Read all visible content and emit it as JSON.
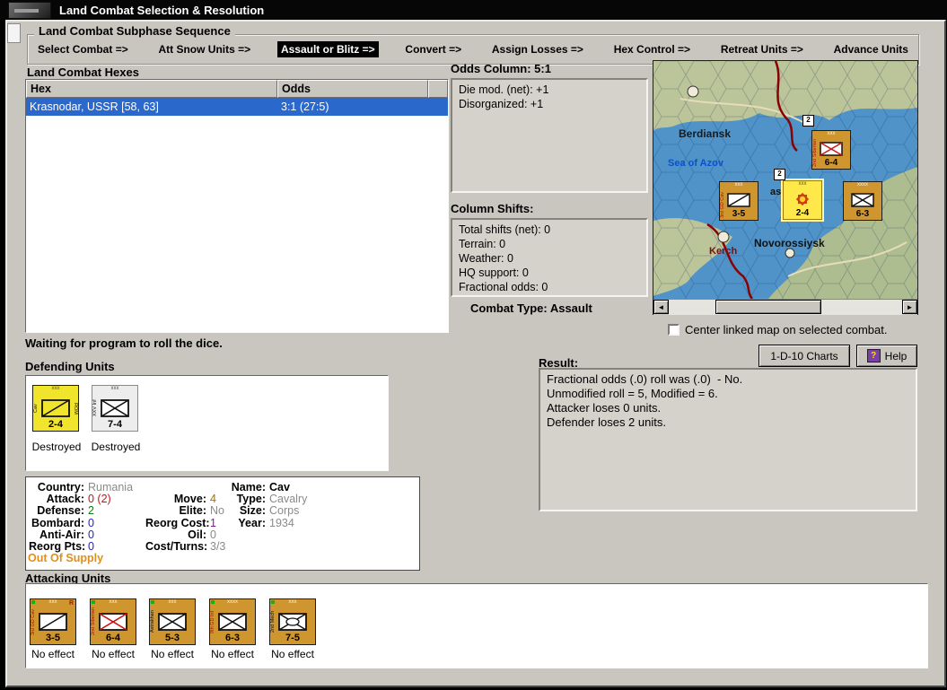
{
  "colors": {
    "titlebar": "#060606",
    "window_bg": "#c9c6c0",
    "panel_bg": "#d5d2cc",
    "selection_blue": "#2a68cc",
    "counter_orange": "#cf9630",
    "counter_yellow": "#f0e42c",
    "supply_warning_text": "#e09018",
    "map_sea": "#4f93c8",
    "map_land": "#bcc49a",
    "front_line_red": "#8b0000"
  },
  "window": {
    "title": "Land Combat Selection & Resolution"
  },
  "subphase": {
    "group_label": "Land Combat Subphase Sequence",
    "steps": [
      {
        "label": "Select Combat =>",
        "active": false
      },
      {
        "label": "Att Snow Units =>",
        "active": false
      },
      {
        "label": "Assault or Blitz =>",
        "active": true
      },
      {
        "label": "Convert =>",
        "active": false
      },
      {
        "label": "Assign Losses =>",
        "active": false
      },
      {
        "label": "Hex Control =>",
        "active": false
      },
      {
        "label": "Retreat Units =>",
        "active": false
      },
      {
        "label": "Advance Units",
        "active": false
      }
    ]
  },
  "hexes": {
    "section_label": "Land Combat Hexes",
    "col_hex": "Hex",
    "col_odds": "Odds",
    "row": {
      "hex": "Krasnodar, USSR [58, 63]",
      "odds": "3:1 (27:5)",
      "selected": true
    }
  },
  "odds": {
    "title": "Odds Column: 5:1",
    "line1": "Die mod. (net): +1",
    "line2": "Disorganized: +1"
  },
  "shifts": {
    "title": "Column Shifts:",
    "line1": "Total shifts (net): 0",
    "line2": "Terrain: 0",
    "line3": "Weather: 0",
    "line4": "HQ support: 0",
    "line5": "Fractional odds: 0"
  },
  "combat_type": "Combat Type: Assault",
  "map": {
    "label_berdiansk": "Berdiansk",
    "label_sea": "Sea of Azov",
    "label_kerch": "Kerch",
    "label_novorossiysk": "Novorossiysk",
    "label_fragment": "as",
    "counters": [
      {
        "strength": "6-4",
        "name": "2nd Siberian",
        "badge": "2",
        "size": "xxx"
      },
      {
        "strength": "3-5",
        "name": "3rd GD Cav",
        "size": "xxx"
      },
      {
        "strength": "2-4",
        "badge": "2",
        "size": "xxx"
      },
      {
        "strength": "6-3",
        "size": "xxxx"
      }
    ]
  },
  "map_options": {
    "center_checkbox_label": "Center linked map on selected combat.",
    "checked": false
  },
  "status_text": "Waiting for program to roll the dice.",
  "defending": {
    "section_label": "Defending Units",
    "units": [
      {
        "strength": "2-4",
        "status": "Destroyed",
        "left_text": "Cav",
        "right_text": "ROM",
        "size": "xxx"
      },
      {
        "strength": "7-4",
        "status": "Destroyed",
        "left_text": "XXV Inf",
        "size": "xxx"
      }
    ]
  },
  "details": {
    "country_label": "Country:",
    "country": "Rumania",
    "attack_label": "Attack:",
    "attack": "0 (2)",
    "defense_label": "Defense:",
    "defense": "2",
    "bombard_label": "Bombard:",
    "bombard": "0",
    "antiair_label": "Anti-Air:",
    "antiair": "0",
    "reorgpts_label": "Reorg Pts:",
    "reorgpts": "0",
    "move_label": "Move:",
    "move": "4",
    "elite_label": "Elite:",
    "elite": "No",
    "reorgcost_label": "Reorg Cost:",
    "reorgcost": "1",
    "oil_label": "Oil:",
    "oil": "0",
    "costturns_label": "Cost/Turns:",
    "costturns": "3/3",
    "name_label": "Name:",
    "name": "Cav",
    "type_label": "Type:",
    "type": "Cavalry",
    "size_label": "Size:",
    "size": "Corps",
    "year_label": "Year:",
    "year": "1934",
    "supply": "Out Of Supply"
  },
  "result": {
    "title": "Result:",
    "line1": "Fractional odds (.0) roll was (.0)  - No.",
    "line2": "Unmodified roll = 5, Modified = 6.",
    "line3": "Attacker loses 0 units.",
    "line4": "Defender loses 2 units."
  },
  "buttons": {
    "charts": "1-D-10 Charts",
    "help": "Help"
  },
  "attacking": {
    "section_label": "Attacking Units",
    "units": [
      {
        "strength": "3-5",
        "name": "3rd GD Cav",
        "effect": "No effect",
        "size": "xxx",
        "corner": "R"
      },
      {
        "strength": "6-4",
        "name": "2nd Siberian",
        "effect": "No effect",
        "size": "xxx"
      },
      {
        "strength": "5-3",
        "name": "Astrakhan",
        "effect": "No effect",
        "size": "xxx"
      },
      {
        "strength": "6-3",
        "name": "9th GD Inf",
        "effect": "No effect",
        "size": "xxxx"
      },
      {
        "strength": "7-5",
        "name": "2nd Mech",
        "effect": "No effect",
        "size": "xxx"
      }
    ]
  }
}
